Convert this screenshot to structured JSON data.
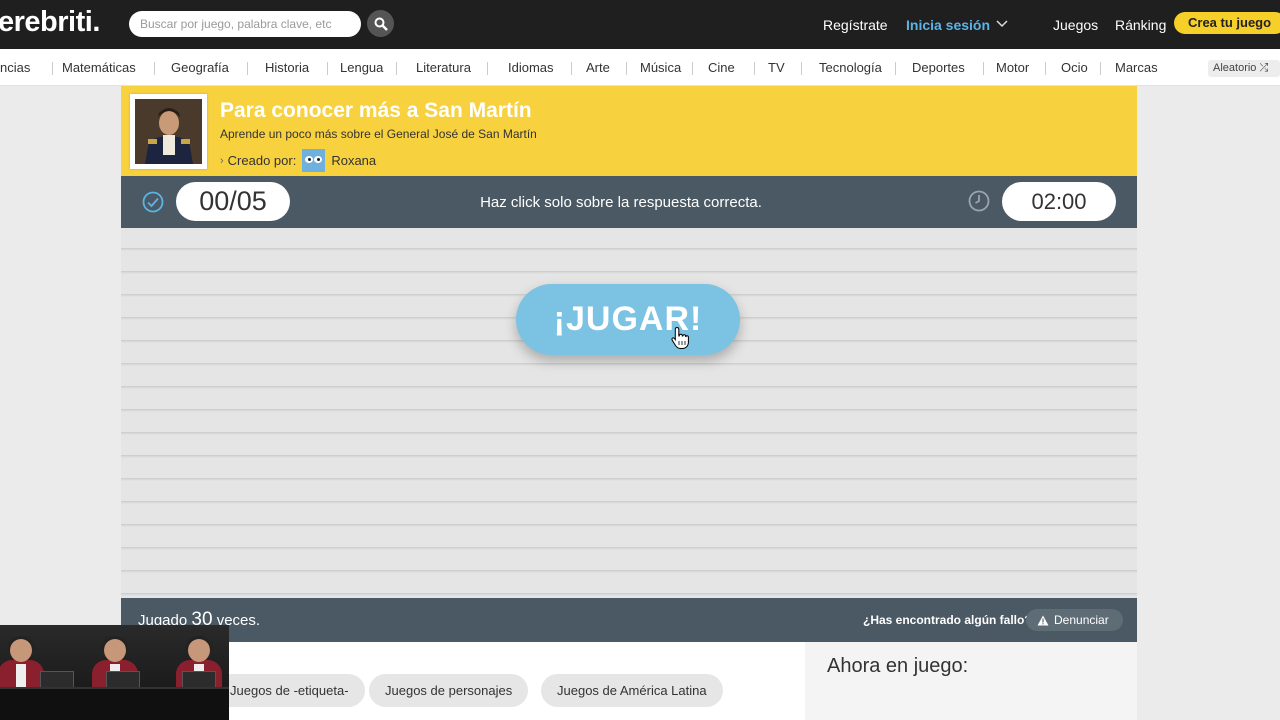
{
  "header": {
    "logo": "erebriti.",
    "search_placeholder": "Buscar por juego, palabra clave, etc",
    "register": "Regístrate",
    "login": "Inicia sesión",
    "games": "Juegos",
    "ranking": "Ránking",
    "create": "Crea tu juego"
  },
  "categories": [
    "ncias",
    "Matemáticas",
    "Geografía",
    "Historia",
    "Lengua",
    "Literatura",
    "Idiomas",
    "Arte",
    "Música",
    "Cine",
    "TV",
    "Tecnología",
    "Deportes",
    "Motor",
    "Ocio",
    "Marcas"
  ],
  "random_label": "Aleatorio",
  "game": {
    "title": "Para conocer más a San Martín",
    "subtitle": "Aprende un poco más sobre el General José de San Martín",
    "created_by_label": "Creado por:",
    "creator": "Roxana",
    "score": "00/05",
    "instruction": "Haz click solo sobre la respuesta correcta.",
    "timer": "02:00",
    "play_button": "¡JUGAR!",
    "played_prefix": "Jugado",
    "played_count": "30",
    "played_suffix": "veces.",
    "fault_question": "¿Has encontrado algún fallo?",
    "report": "Denunciar"
  },
  "tags": [
    "Juegos de -etiqueta-",
    "Juegos de personajes",
    "Juegos de América Latina"
  ],
  "now_playing": {
    "title": "Ahora en juego:"
  },
  "colors": {
    "brand_yellow": "#f8d13f",
    "login_blue": "#5bb4e5",
    "status_bar": "#4a5963",
    "play_button": "#7cc2e3"
  }
}
